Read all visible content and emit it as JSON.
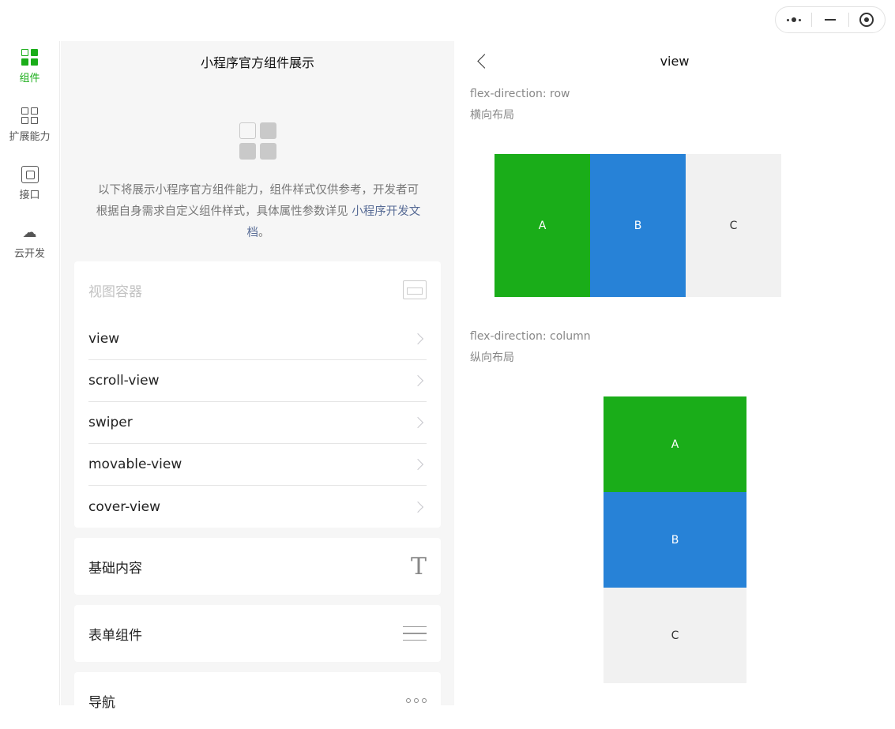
{
  "tabbar": {
    "items": [
      {
        "label": "组件",
        "icon": "components-icon",
        "active": true
      },
      {
        "label": "扩展能力",
        "icon": "extension-icon",
        "active": false
      },
      {
        "label": "接口",
        "icon": "api-chip-icon",
        "active": false
      },
      {
        "label": "云开发",
        "icon": "cloud-icon",
        "active": false
      }
    ]
  },
  "middle": {
    "title": "小程序官方组件展示",
    "intro_text": "以下将展示小程序官方组件能力，组件样式仅供参考，开发者可根据自身需求自定义组件样式，具体属性参数详见",
    "intro_link": "小程序开发文档",
    "intro_end": "。",
    "sections": {
      "view_container": {
        "title": "视图容器",
        "items": [
          "view",
          "scroll-view",
          "swiper",
          "movable-view",
          "cover-view"
        ]
      },
      "basic": {
        "title": "基础内容"
      },
      "form": {
        "title": "表单组件"
      },
      "nav": {
        "title": "导航"
      }
    }
  },
  "page": {
    "title": "view",
    "row_caption_1": "flex-direction: row",
    "row_caption_2": "横向布局",
    "col_caption_1": "flex-direction: column",
    "col_caption_2": "纵向布局",
    "boxes": [
      "A",
      "B",
      "C"
    ]
  },
  "colors": {
    "accent": "#1aad19",
    "blue": "#2782d7",
    "light": "#f1f1f1",
    "link": "#576b95"
  }
}
